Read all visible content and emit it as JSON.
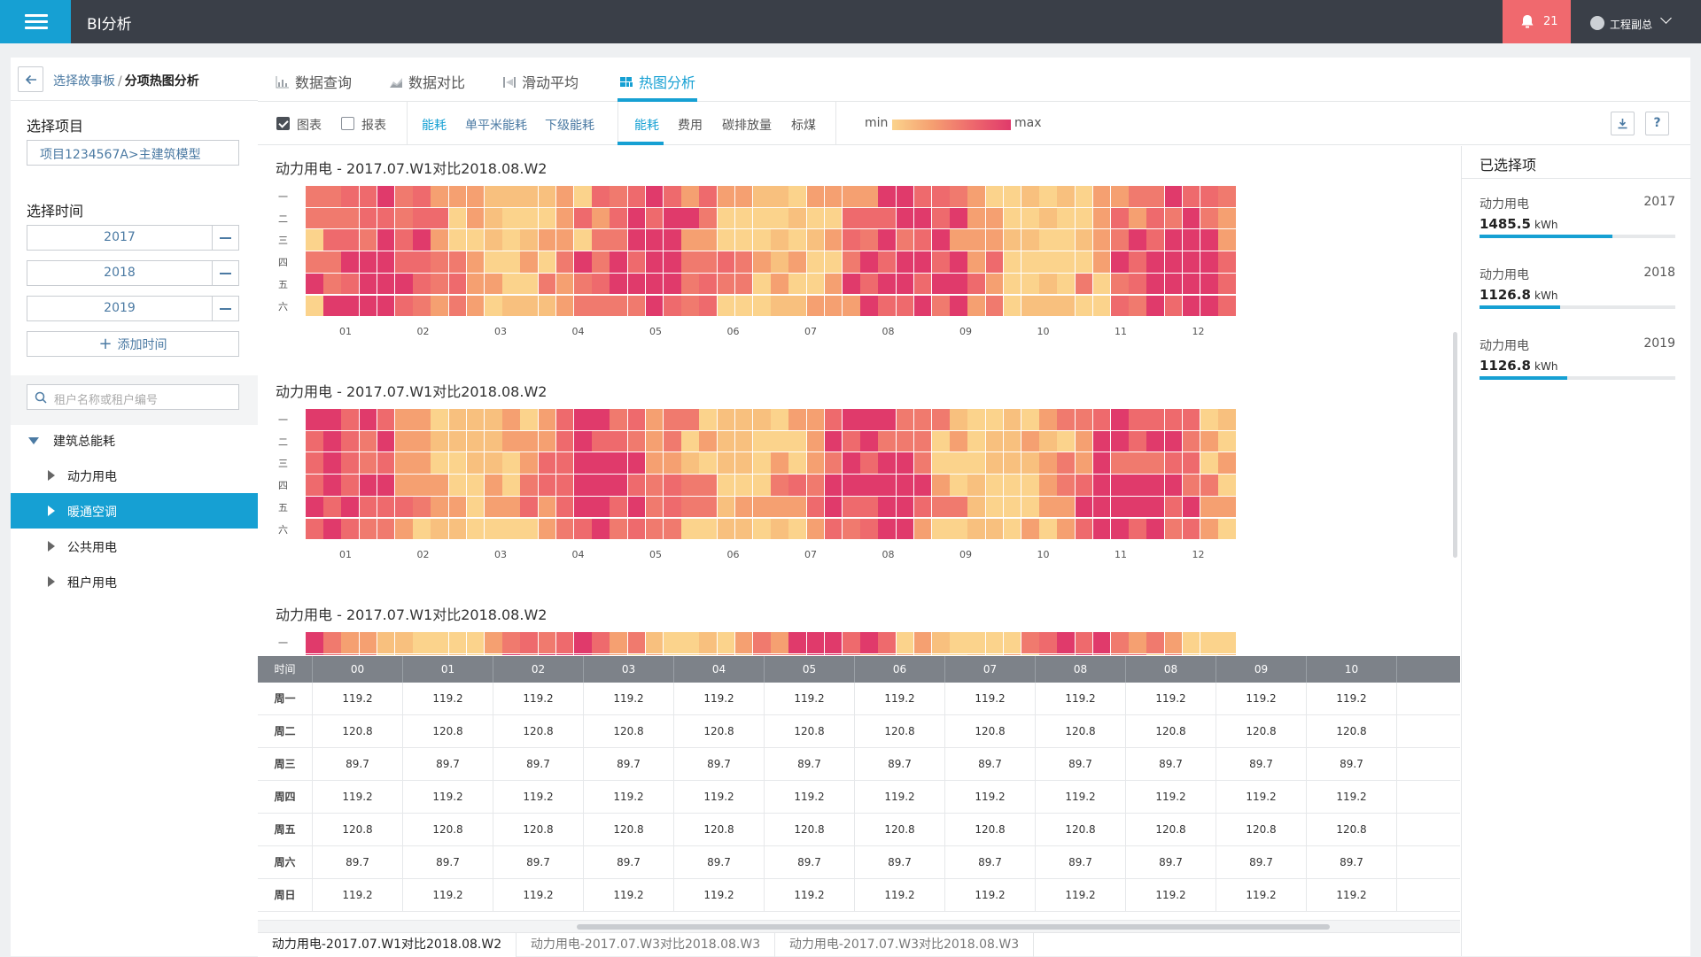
{
  "app": {
    "title": "BI分析",
    "notifications": "21",
    "user": "工程副总"
  },
  "breadcrumb": {
    "parent": "选择故事板",
    "sep": "/",
    "current": "分项热图分析"
  },
  "left": {
    "project_title": "选择项目",
    "project_value": "项目1234567A>主建筑模型",
    "time_title": "选择时间",
    "years": [
      "2017",
      "2018",
      "2019"
    ],
    "add_time": "添加时间",
    "search_placeholder": "租户名称或租户编号",
    "tree": [
      {
        "label": "建筑总能耗",
        "level": 0,
        "expanded": true
      },
      {
        "label": "动力用电",
        "level": 1
      },
      {
        "label": "暖通空调",
        "level": 1,
        "active": true
      },
      {
        "label": "公共用电",
        "level": 1
      },
      {
        "label": "租户用电",
        "level": 1
      }
    ]
  },
  "tabs": [
    {
      "label": "数据查询",
      "icon": "bar-chart-icon"
    },
    {
      "label": "数据对比",
      "icon": "area-chart-icon"
    },
    {
      "label": "滑动平均",
      "icon": "moving-average-icon"
    },
    {
      "label": "热图分析",
      "icon": "heatmap-icon",
      "active": true
    }
  ],
  "toolbar": {
    "chart_label": "图表",
    "chart_checked": true,
    "report_label": "报表",
    "report_checked": false,
    "group1": [
      "能耗",
      "单平米能耗",
      "下级能耗"
    ],
    "group2": [
      "能耗",
      "费用",
      "碳排放量",
      "标煤"
    ],
    "legend_min": "min",
    "legend_max": "max",
    "download_icon": "download-icon",
    "help": "?"
  },
  "charts": [
    {
      "title": "动力用电 - 2017.07.W1对比2018.08.W2"
    },
    {
      "title": "动力用电 - 2017.07.W1对比2018.08.W2"
    },
    {
      "title": "动力用电 - 2017.07.W1对比2018.08.W2"
    }
  ],
  "chart_data": {
    "type": "heatmap",
    "ylabels": [
      "一",
      "二",
      "三",
      "四",
      "五",
      "六"
    ],
    "xlabels": [
      "01",
      "02",
      "03",
      "04",
      "05",
      "06",
      "07",
      "08",
      "09",
      "10",
      "11",
      "12"
    ],
    "scale": {
      "min_label": "min",
      "max_label": "max",
      "colors": [
        "#fbd38c",
        "#f5a071",
        "#ee6a6d",
        "#e03a6b"
      ]
    }
  },
  "selected": {
    "title": "已选择项",
    "items": [
      {
        "name": "动力用电",
        "year": "2017",
        "value": "1485.5",
        "unit": "kWh",
        "level": 0.68
      },
      {
        "name": "动力用电",
        "year": "2018",
        "value": "1126.8",
        "unit": "kWh",
        "level": 0.41
      },
      {
        "name": "动力用电",
        "year": "2019",
        "value": "1126.8",
        "unit": "kWh",
        "level": 0.45
      }
    ]
  },
  "table": {
    "columns": [
      "时间",
      "00",
      "01",
      "02",
      "03",
      "04",
      "05",
      "06",
      "07",
      "08",
      "08",
      "09",
      "10"
    ],
    "rows": [
      {
        "label": "周一",
        "value": "119.2"
      },
      {
        "label": "周二",
        "value": "120.8"
      },
      {
        "label": "周三",
        "value": "89.7"
      },
      {
        "label": "周四",
        "value": "119.2"
      },
      {
        "label": "周五",
        "value": "120.8"
      },
      {
        "label": "周六",
        "value": "89.7"
      },
      {
        "label": "周日",
        "value": "119.2"
      }
    ]
  },
  "bottom_tabs": [
    "动力用电-2017.07.W1对比2018.08.W2",
    "动力用电-2017.07.W3对比2018.08.W3",
    "动力用电-2017.07.W3对比2018.08.W3"
  ]
}
